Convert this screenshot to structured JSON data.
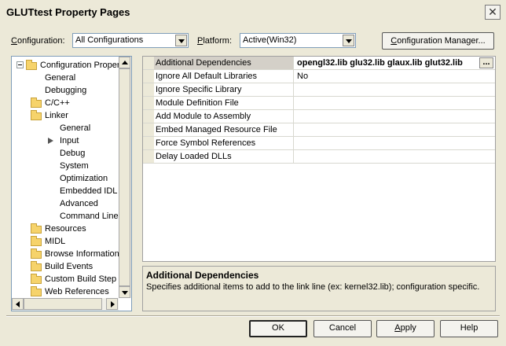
{
  "window": {
    "title": "GLUTtest Property Pages"
  },
  "configuration": {
    "label_prefix": "",
    "label_key": "C",
    "label_rest": "onfiguration:",
    "value": "All Configurations"
  },
  "platform": {
    "label_key": "P",
    "label_rest": "latform:",
    "value": "Active(Win32)"
  },
  "config_manager_button": {
    "key": "C",
    "rest": "onfiguration Manager..."
  },
  "tree": {
    "items": [
      {
        "label": "Configuration Propertie"
      },
      {
        "label": "General"
      },
      {
        "label": "Debugging"
      },
      {
        "label": "C/C++"
      },
      {
        "label": "Linker"
      },
      {
        "label": "General"
      },
      {
        "label": "Input"
      },
      {
        "label": "Debug"
      },
      {
        "label": "System"
      },
      {
        "label": "Optimization"
      },
      {
        "label": "Embedded IDL"
      },
      {
        "label": "Advanced"
      },
      {
        "label": "Command Line"
      },
      {
        "label": "Resources"
      },
      {
        "label": "MIDL"
      },
      {
        "label": "Browse Information"
      },
      {
        "label": "Build Events"
      },
      {
        "label": "Custom Build Step"
      },
      {
        "label": "Web References"
      }
    ]
  },
  "properties": [
    {
      "name": "Additional Dependencies",
      "value": "opengl32.lib glu32.lib glaux.lib glut32.lib"
    },
    {
      "name": "Ignore All Default Libraries",
      "value": "No"
    },
    {
      "name": "Ignore Specific Library",
      "value": ""
    },
    {
      "name": "Module Definition File",
      "value": ""
    },
    {
      "name": "Add Module to Assembly",
      "value": ""
    },
    {
      "name": "Embed Managed Resource File",
      "value": ""
    },
    {
      "name": "Force Symbol References",
      "value": ""
    },
    {
      "name": "Delay Loaded DLLs",
      "value": ""
    }
  ],
  "ellipsis_label": "...",
  "description": {
    "title": "Additional Dependencies",
    "text": "Specifies additional items to add to the link line (ex: kernel32.lib); configuration specific."
  },
  "buttons": {
    "ok": "OK",
    "cancel": "Cancel",
    "apply_key": "A",
    "apply_rest": "pply",
    "help": "Help"
  },
  "icons": {
    "close": "close-icon",
    "folder": "folder-icon",
    "expander": "collapse-icon",
    "current": "arrow-right-icon"
  }
}
